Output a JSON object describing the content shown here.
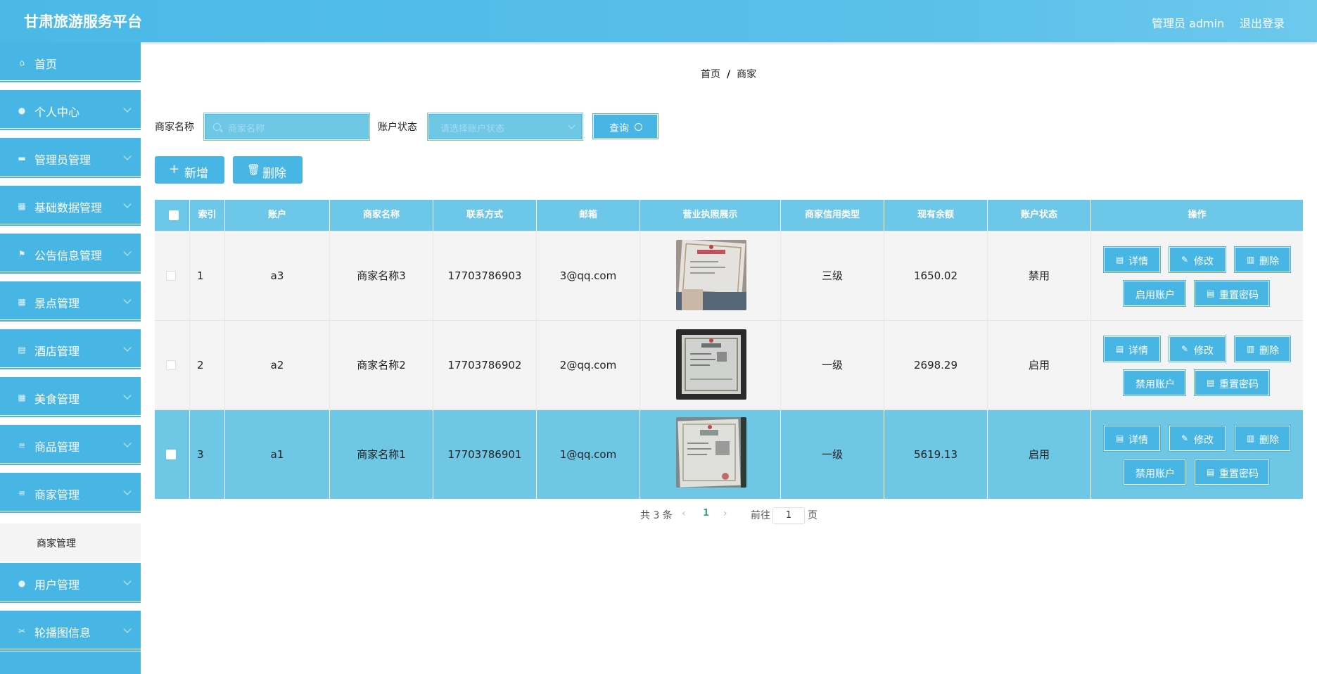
{
  "header": {
    "title": "甘肃旅游服务平台",
    "user_label": "管理员 admin",
    "logout_label": "退出登录"
  },
  "sidebar": {
    "items": [
      {
        "label": "首页",
        "icon": "home-icon"
      },
      {
        "label": "个人中心",
        "icon": "user-icon"
      },
      {
        "label": "管理员管理",
        "icon": "monitor-icon"
      },
      {
        "label": "基础数据管理",
        "icon": "grid-icon"
      },
      {
        "label": "公告信息管理",
        "icon": "flag-icon"
      },
      {
        "label": "景点管理",
        "icon": "grid-icon"
      },
      {
        "label": "酒店管理",
        "icon": "clipboard-icon"
      },
      {
        "label": "美食管理",
        "icon": "grid-icon"
      },
      {
        "label": "商品管理",
        "icon": "list-icon"
      },
      {
        "label": "商家管理",
        "icon": "list-icon"
      },
      {
        "label": "用户管理",
        "icon": "user-icon"
      },
      {
        "label": "轮播图信息",
        "icon": "ticket-icon"
      }
    ],
    "active_sub_item": "商家管理"
  },
  "breadcrumb": {
    "home": "首页",
    "separator": "/",
    "current": "商家"
  },
  "filters": {
    "name_label": "商家名称",
    "name_placeholder": "商家名称",
    "status_label": "账户状态",
    "status_placeholder": "请选择账户状态",
    "query_label": "查询"
  },
  "actions": {
    "add_label": "新增",
    "delete_label": "删除"
  },
  "table": {
    "columns": [
      "索引",
      "账户",
      "商家名称",
      "联系方式",
      "邮箱",
      "营业执照展示",
      "商家信用类型",
      "现有余额",
      "账户状态",
      "操作"
    ],
    "rows": [
      {
        "index": "1",
        "account": "a3",
        "name": "商家名称3",
        "phone": "17703786903",
        "email": "3@qq.com",
        "credit": "三级",
        "balance": "1650.02",
        "status": "禁用",
        "toggle_label": "启用账户"
      },
      {
        "index": "2",
        "account": "a2",
        "name": "商家名称2",
        "phone": "17703786902",
        "email": "2@qq.com",
        "credit": "一级",
        "balance": "2698.29",
        "status": "启用",
        "toggle_label": "禁用账户"
      },
      {
        "index": "3",
        "account": "a1",
        "name": "商家名称1",
        "phone": "17703786901",
        "email": "1@qq.com",
        "credit": "一级",
        "balance": "5619.13",
        "status": "启用",
        "toggle_label": "禁用账户"
      }
    ],
    "op_labels": {
      "detail": "详情",
      "edit": "修改",
      "delete": "删除",
      "reset": "重置密码"
    }
  },
  "pagination": {
    "total_label": "共 3 条",
    "current_page": "1",
    "goto_label": "前往",
    "goto_value": "1",
    "page_suffix": "页"
  },
  "colors": {
    "primary": "#47b6e4",
    "header_row": "#6cc7e8",
    "selected_row": "#6fc7e6",
    "stripe_row": "#f4f4f4"
  }
}
